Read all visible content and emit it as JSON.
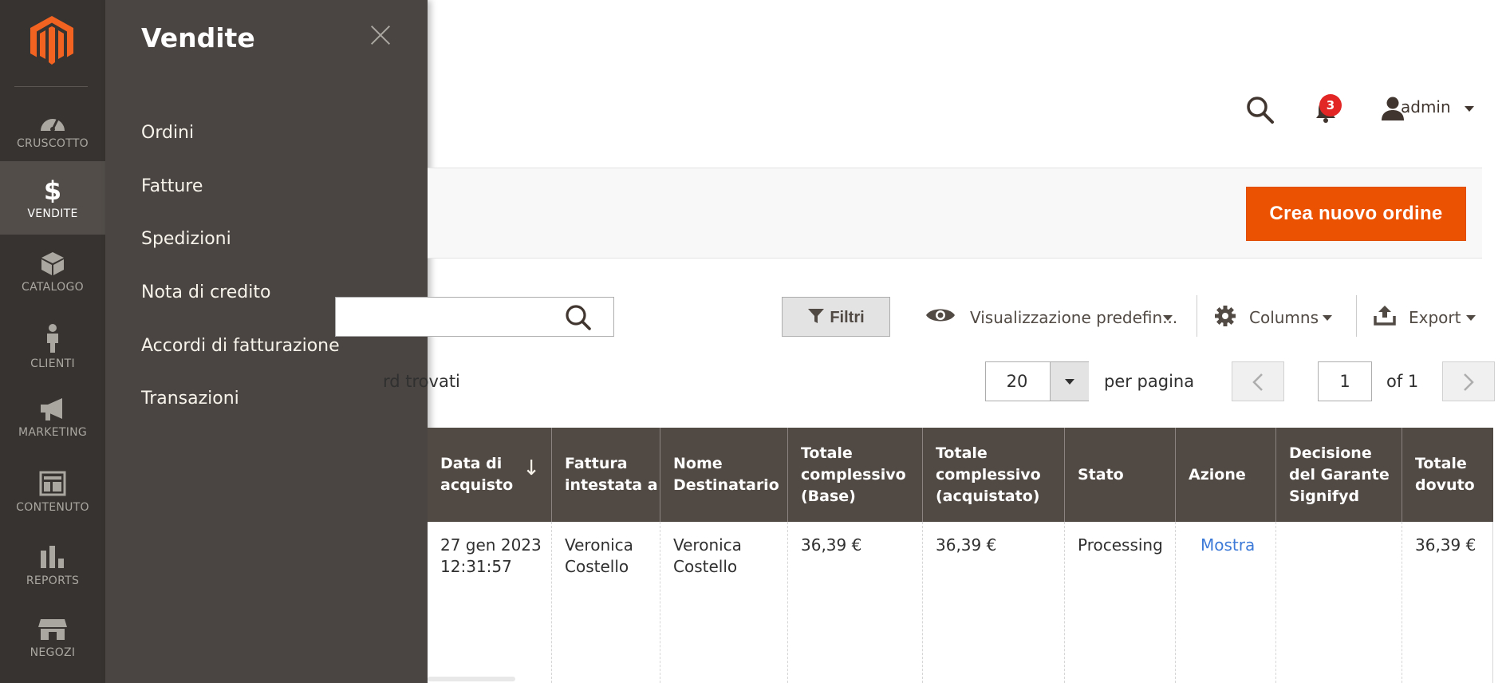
{
  "nav": {
    "items": [
      {
        "label": "CRUSCOTTO",
        "icon": "dashboard-icon"
      },
      {
        "label": "VENDITE",
        "icon": "dollar-icon"
      },
      {
        "label": "CATALOGO",
        "icon": "box-icon"
      },
      {
        "label": "CLIENTI",
        "icon": "person-icon"
      },
      {
        "label": "MARKETING",
        "icon": "megaphone-icon"
      },
      {
        "label": "CONTENUTO",
        "icon": "layout-icon"
      },
      {
        "label": "REPORTS",
        "icon": "bar-chart-icon"
      },
      {
        "label": "NEGOZI",
        "icon": "store-icon"
      }
    ],
    "active_index": 1
  },
  "submenu": {
    "title": "Vendite",
    "items": [
      "Ordini",
      "Fatture",
      "Spedizioni",
      "Nota di credito",
      "Accordi di fatturazione",
      "Transazioni"
    ]
  },
  "header": {
    "notification_count": "3",
    "user": "admin"
  },
  "actions": {
    "create_order": "Crea nuovo ordine"
  },
  "toolbar": {
    "filters": "Filtri",
    "view": "Visualizzazione predefin...",
    "columns": "Columns",
    "export": "Export",
    "records_found": "rd trovati",
    "per_page_value": "20",
    "per_page_label": "per pagina",
    "page": "1",
    "page_of": "of 1"
  },
  "table": {
    "columns": [
      {
        "label": "Data di acquisto",
        "lines": [
          "Data di",
          "acquisto"
        ]
      },
      {
        "label": "Fattura intestata a",
        "lines": [
          "Fattura",
          "intestata a"
        ]
      },
      {
        "label": "Nome Destinatario",
        "lines": [
          "Nome",
          "Destinatario"
        ]
      },
      {
        "label": "Totale complessivo (Base)",
        "lines": [
          "Totale",
          "complessivo",
          "(Base)"
        ]
      },
      {
        "label": "Totale complessivo (acquistato)",
        "lines": [
          "Totale",
          "complessivo",
          "(acquistato)"
        ]
      },
      {
        "label": "Stato",
        "lines": [
          "Stato"
        ]
      },
      {
        "label": "Azione",
        "lines": [
          "Azione"
        ]
      },
      {
        "label": "Decisione del Garante Signifyd",
        "lines": [
          "Decisione",
          "del Garante",
          "Signifyd"
        ]
      },
      {
        "label": "Totale dovuto",
        "lines": [
          "Totale",
          "dovuto"
        ]
      }
    ],
    "sort_indicator": "↓",
    "rows": [
      {
        "purchase_date": [
          "27 gen 2023",
          "12:31:57"
        ],
        "bill_to": [
          "Veronica",
          "Costello"
        ],
        "ship_to": [
          "Veronica",
          "Costello"
        ],
        "grand_total_base": "36,39 €",
        "grand_total_purchased": "36,39 €",
        "status": "Processing",
        "action": "Mostra",
        "signifyd": "",
        "total_due": "36,39 €"
      }
    ]
  },
  "colors": {
    "nav_bg": "#373330",
    "submenu_bg": "#4a4542",
    "accent": "#eb5202",
    "table_header_bg": "#514943",
    "link": "#3d7ad8",
    "badge": "#e22626"
  }
}
